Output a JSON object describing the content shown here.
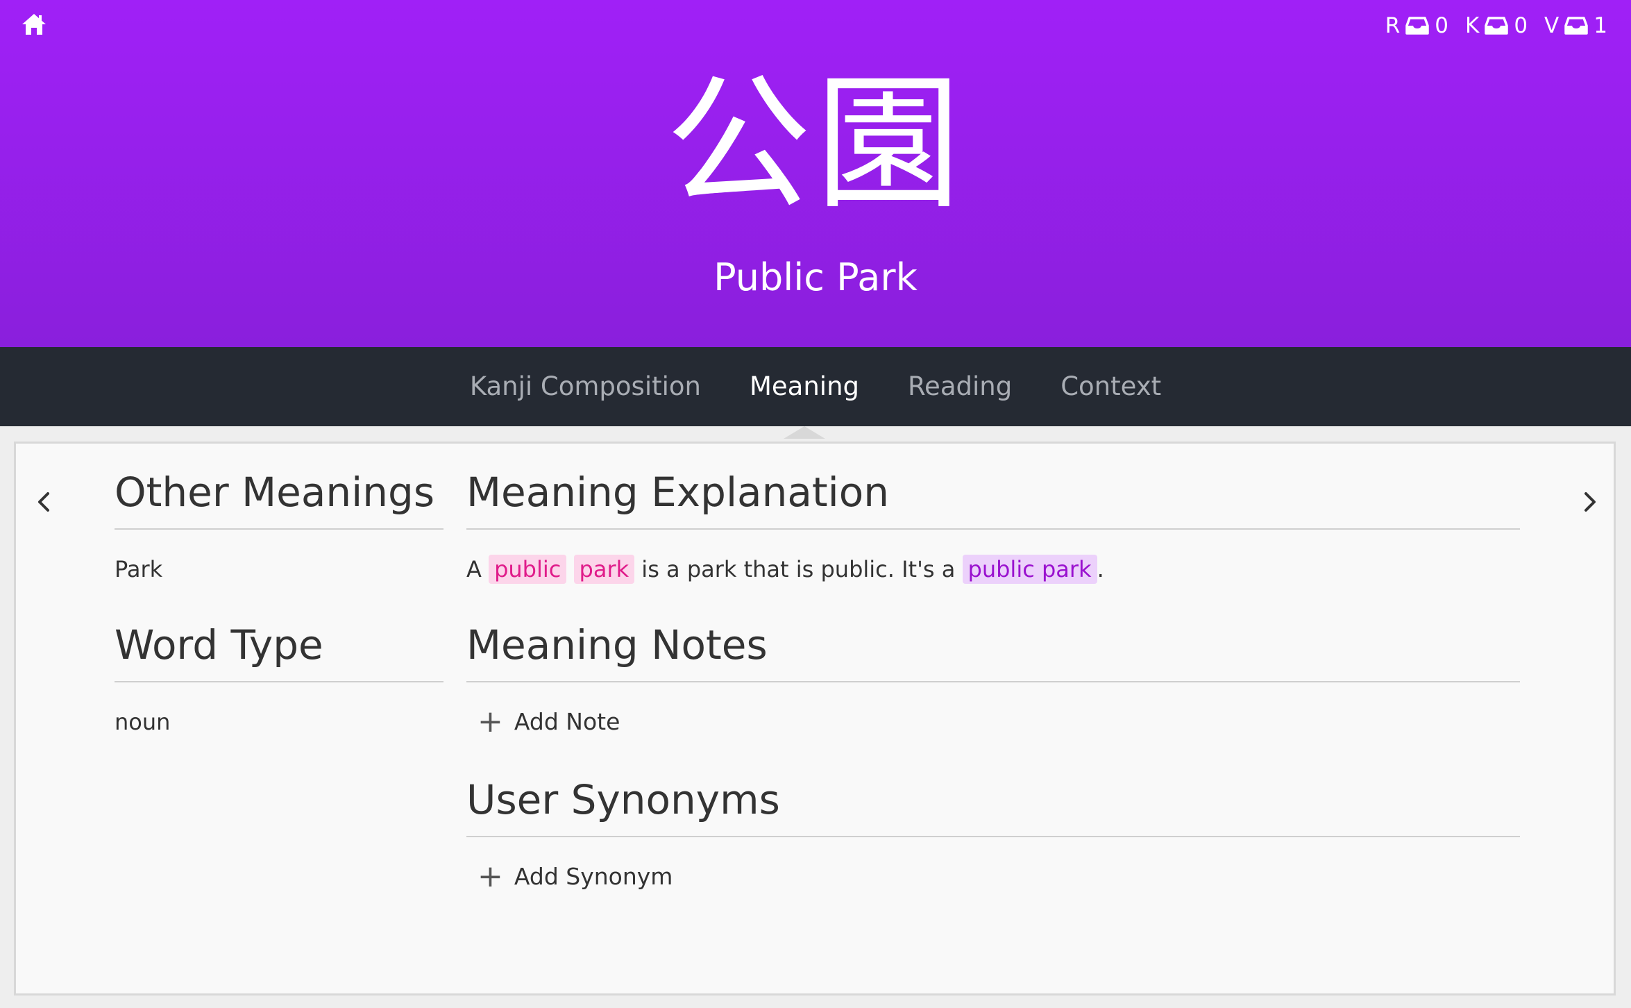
{
  "header": {
    "characters": "公園",
    "meaning": "Public Park",
    "queues": [
      {
        "letter": "R",
        "count": "0"
      },
      {
        "letter": "K",
        "count": "0"
      },
      {
        "letter": "V",
        "count": "1"
      }
    ],
    "icons": {
      "home": "home-icon",
      "queue": "inbox-tray-icon"
    }
  },
  "tabs": [
    {
      "label": "Kanji Composition"
    },
    {
      "label": "Meaning"
    },
    {
      "label": "Reading"
    },
    {
      "label": "Context"
    }
  ],
  "active_tab": "Meaning",
  "left_column": {
    "other_meanings_title": "Other Meanings",
    "other_meanings_value": "Park",
    "word_type_title": "Word Type",
    "word_type_value": "noun"
  },
  "right_column": {
    "explanation_title": "Meaning Explanation",
    "explanation": {
      "part1": "A ",
      "hl1": "public",
      "hl2": "park",
      "part2": " is a park that is public. It's a ",
      "hl3": "public park",
      "part3": "."
    },
    "notes_title": "Meaning Notes",
    "add_note_label": "Add Note",
    "synonyms_title": "User Synonyms",
    "add_synonym_label": "Add Synonym"
  },
  "colors": {
    "header_gradient_top": "#a020f7",
    "header_gradient_bottom": "#8a1fdc",
    "tab_bar": "#252a33",
    "highlight_pink": "#e01b8a",
    "highlight_purple": "#9a11cf"
  }
}
